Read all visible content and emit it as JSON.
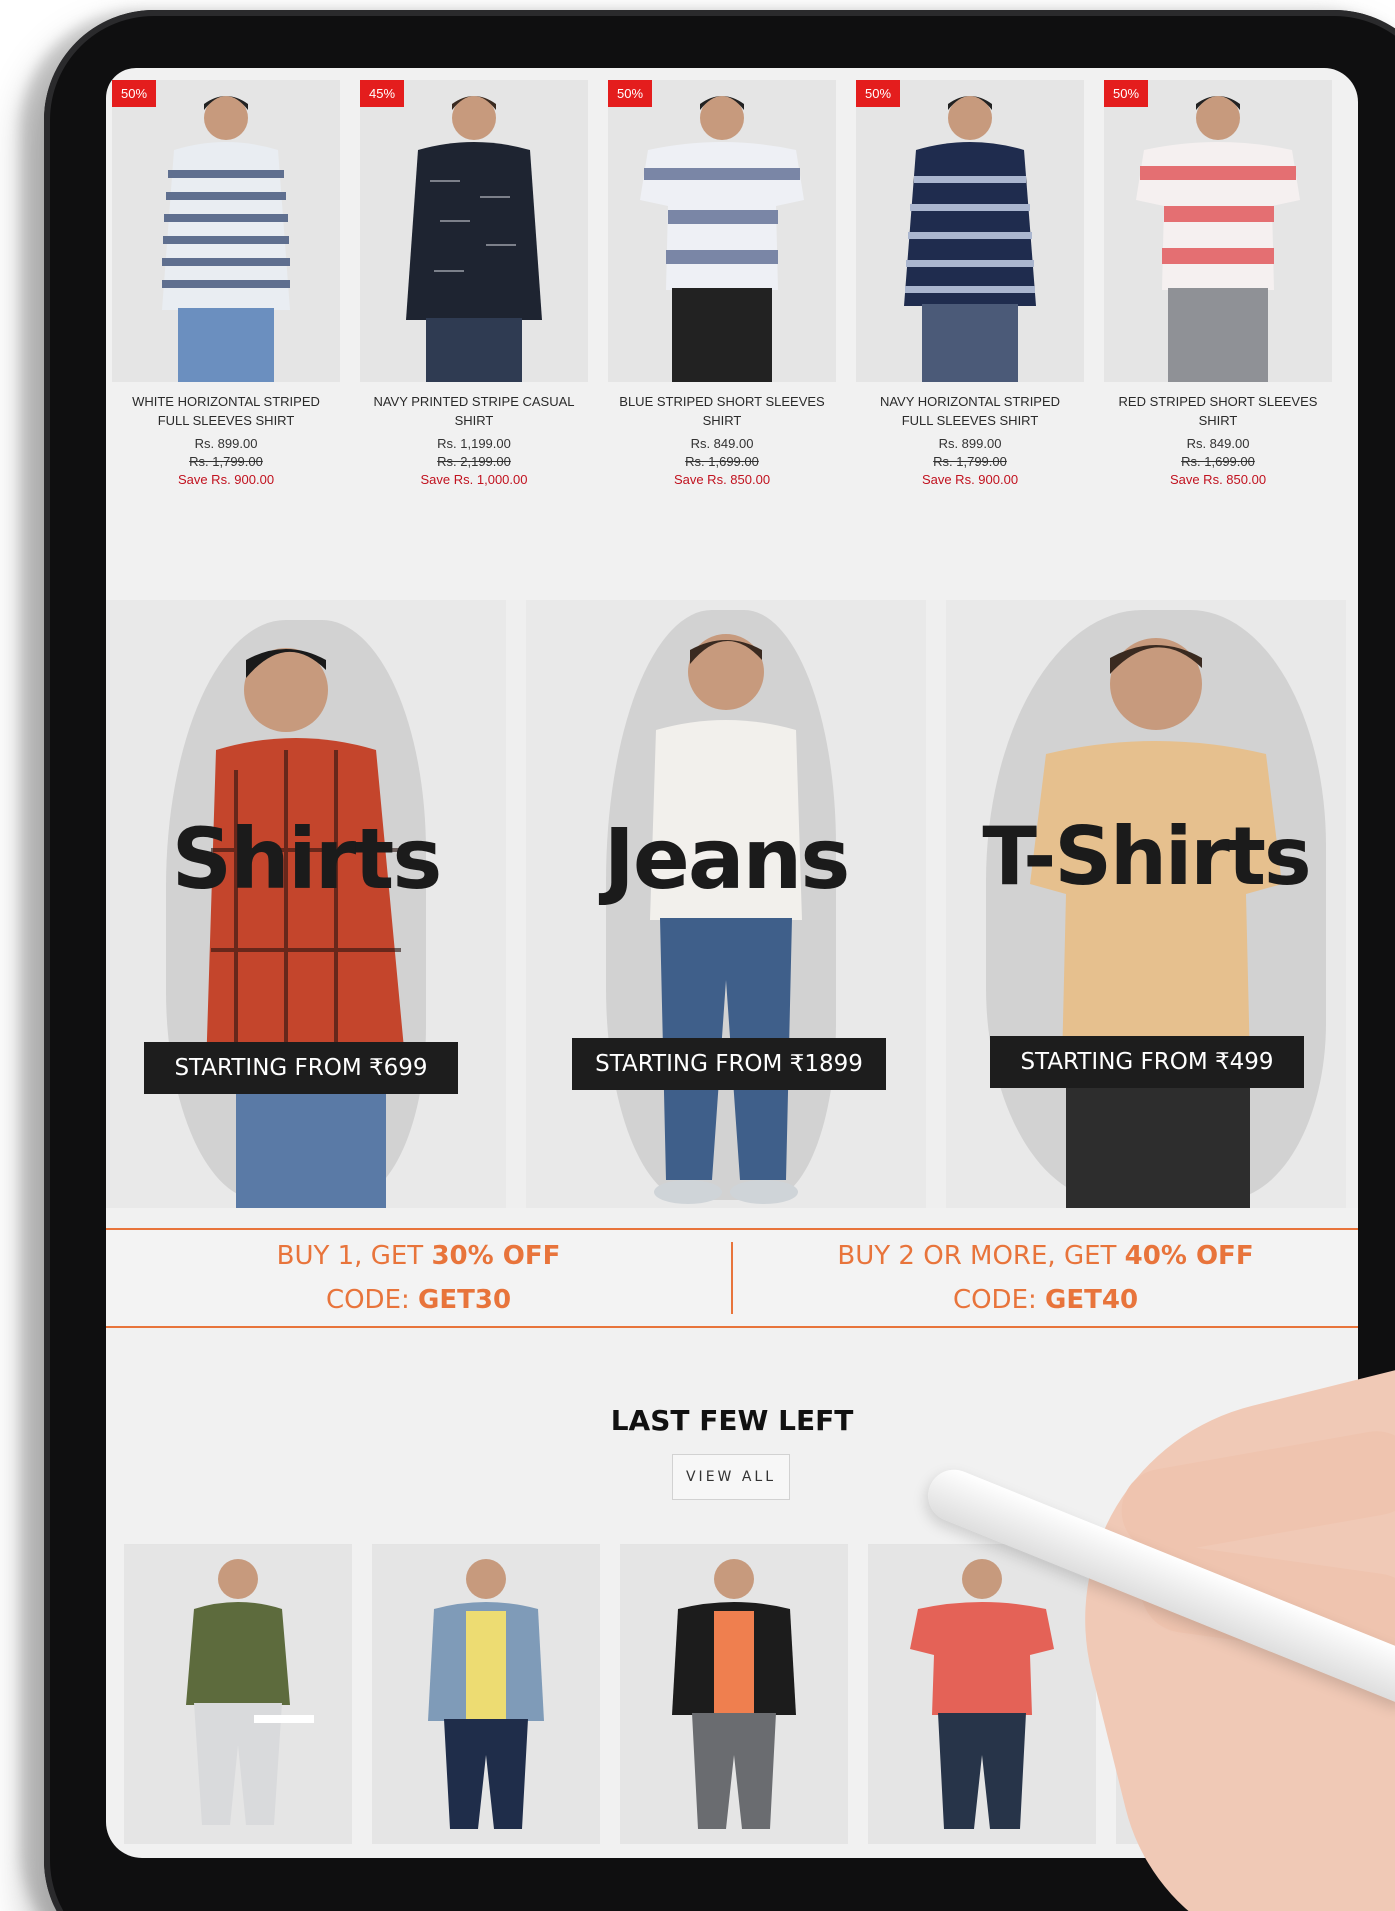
{
  "top_products": [
    {
      "badge": "50%",
      "name": "WHITE HORIZONTAL STRIPED FULL SLEEVES SHIRT",
      "price": "Rs. 899.00",
      "mrp": "Rs. 1,799.00",
      "save": "Save Rs. 900.00",
      "shirt_color": "#e9edf2",
      "stripe_color": "#5f6f8f",
      "pants_color": "#6b8fbf"
    },
    {
      "badge": "45%",
      "name": "NAVY PRINTED STRIPE CASUAL SHIRT",
      "price": "Rs. 1,199.00",
      "mrp": "Rs. 2,199.00",
      "save": "Save Rs. 1,000.00",
      "shirt_color": "#1e2431",
      "stripe_color": "#1e2431",
      "pants_color": "#2f3b52"
    },
    {
      "badge": "50%",
      "name": "BLUE STRIPED SHORT SLEEVES SHIRT",
      "price": "Rs. 849.00",
      "mrp": "Rs. 1,699.00",
      "save": "Save Rs. 850.00",
      "shirt_color": "#eef0f5",
      "stripe_color": "#7a86a6",
      "pants_color": "#222222"
    },
    {
      "badge": "50%",
      "name": "NAVY HORIZONTAL STRIPED FULL SLEEVES SHIRT",
      "price": "Rs. 899.00",
      "mrp": "Rs. 1,799.00",
      "save": "Save Rs. 900.00",
      "shirt_color": "#1f2c4e",
      "stripe_color": "#aab6cf",
      "pants_color": "#4b5a78"
    },
    {
      "badge": "50%",
      "name": "RED STRIPED SHORT SLEEVES SHIRT",
      "price": "Rs. 849.00",
      "mrp": "Rs. 1,699.00",
      "save": "Save Rs. 850.00",
      "shirt_color": "#f5f0f0",
      "stripe_color": "#e46f72",
      "pants_color": "#8f9196"
    }
  ],
  "categories": [
    {
      "title": "Shirts",
      "cta": "STARTING FROM ₹699",
      "garment_color": "#c4452c",
      "pants_color": "#5a7aa6"
    },
    {
      "title": "Jeans",
      "cta": "STARTING FROM ₹1899",
      "garment_color": "#f2f0ec",
      "pants_color": "#3f5f8a"
    },
    {
      "title": "T-Shirts",
      "cta": "STARTING FROM ₹499",
      "garment_color": "#e6c08e",
      "pants_color": "#2d2d2d"
    }
  ],
  "offers": [
    {
      "line1_prefix": "BUY 1, GET ",
      "line1_bold": "30% OFF",
      "line2_prefix": "CODE: ",
      "line2_bold": "GET30"
    },
    {
      "line1_prefix": "BUY 2 OR MORE, GET ",
      "line1_bold": "40% OFF",
      "line2_prefix": "CODE: ",
      "line2_bold": "GET40"
    }
  ],
  "last_few_left": {
    "title": "LAST FEW LEFT",
    "view_all": "VIEW ALL",
    "products": [
      {
        "name": "",
        "shirt_color": "#5d6b3d",
        "pants_color": "#d9dadc"
      },
      {
        "name": "",
        "shirt_color": "#7f9bb8",
        "pants_color": "#1f2d4a"
      },
      {
        "name": "",
        "shirt_color": "#1c1c1c",
        "pants_color": "#6a6c70"
      },
      {
        "name": "",
        "shirt_color": "#e46257",
        "pants_color": "#273449"
      },
      {
        "name": "",
        "shirt_color": "#e8e8e8",
        "pants_color": "#2f4568"
      }
    ]
  },
  "colors": {
    "accent_orange": "#e8743b",
    "badge_red": "#e41d1d",
    "save_red": "#c1121f"
  }
}
